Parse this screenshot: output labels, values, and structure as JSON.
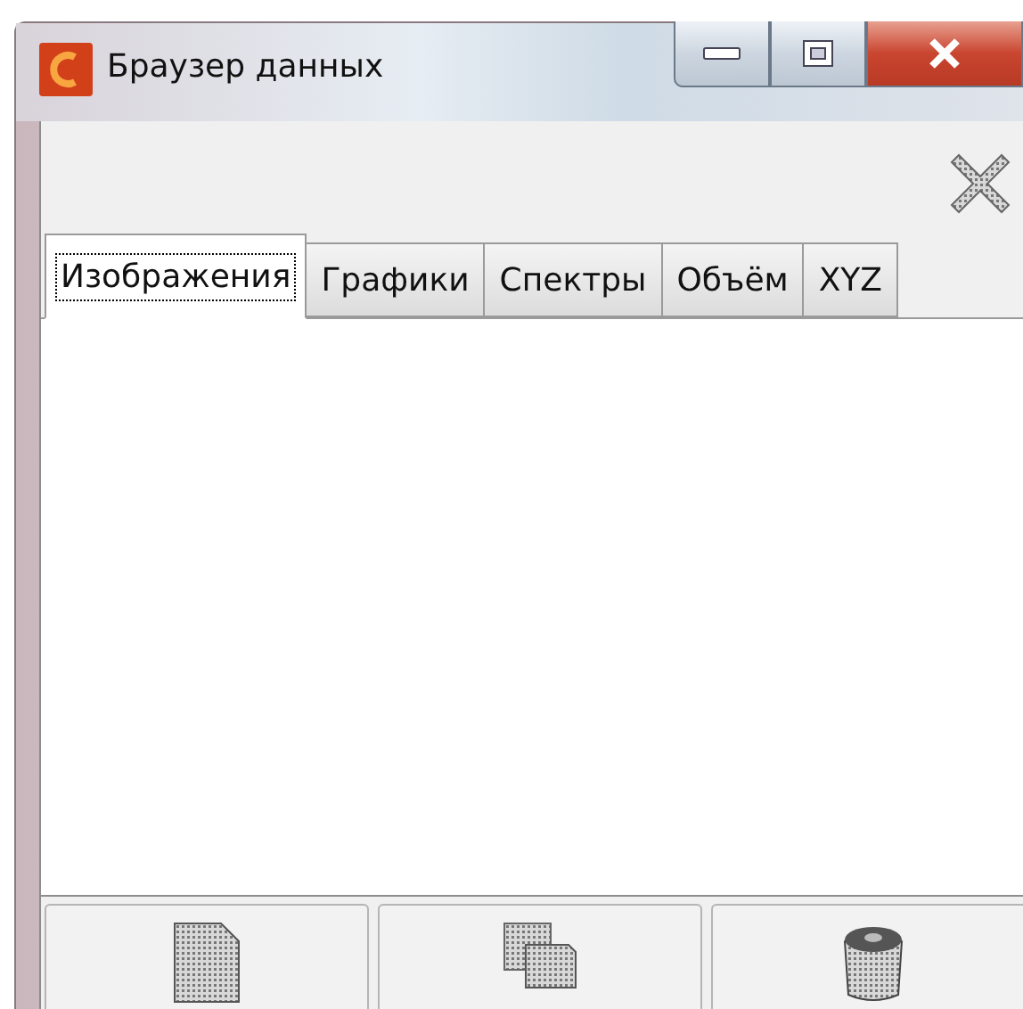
{
  "window": {
    "title": "Браузер данных"
  },
  "tabs": [
    {
      "label": "Изображения",
      "selected": true
    },
    {
      "label": "Графики",
      "selected": false
    },
    {
      "label": "Спектры",
      "selected": false
    },
    {
      "label": "Объём",
      "selected": false
    },
    {
      "label": "XYZ",
      "selected": false
    }
  ],
  "buttons": [
    {
      "kind": "new"
    },
    {
      "kind": "copy"
    },
    {
      "kind": "delete"
    }
  ]
}
